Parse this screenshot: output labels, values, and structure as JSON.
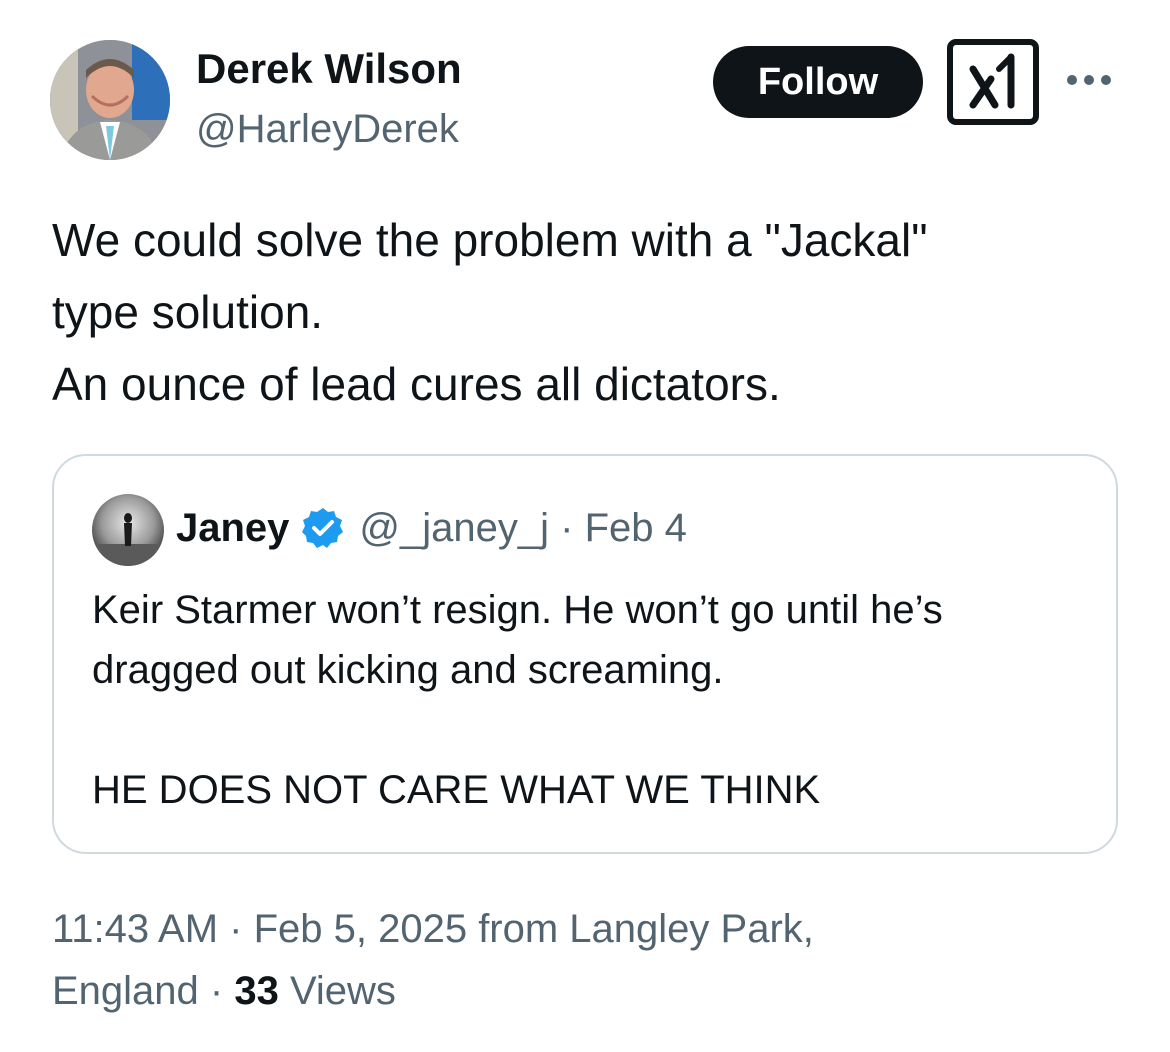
{
  "author": {
    "name": "Derek Wilson",
    "handle": "@HarleyDerek"
  },
  "actions": {
    "follow_label": "Follow",
    "grok_icon": "grok-icon",
    "more_icon": "more-options-icon"
  },
  "tweet": {
    "lines": [
      "We could solve the problem with a \"Jackal\"",
      "type solution.",
      "An ounce of lead cures all dictators."
    ]
  },
  "quoted": {
    "name": "Janey",
    "verified_icon": "verified-badge-icon",
    "meta": "@_janey_j · Feb 4",
    "lines": [
      "Keir Starmer won’t resign. He won’t go until he’s",
      "dragged out kicking and screaming."
    ],
    "line_last": "HE DOES NOT CARE WHAT WE THINK"
  },
  "footer": {
    "line1": "11:43 AM · Feb 5, 2025 from Langley Park,",
    "line2_prefix": "England · ",
    "views_count": "33",
    "views_label": " Views"
  },
  "colors": {
    "text": "#0f1419",
    "secondary": "#536471",
    "border": "#cfd9de",
    "verified": "#1d9bf0"
  }
}
